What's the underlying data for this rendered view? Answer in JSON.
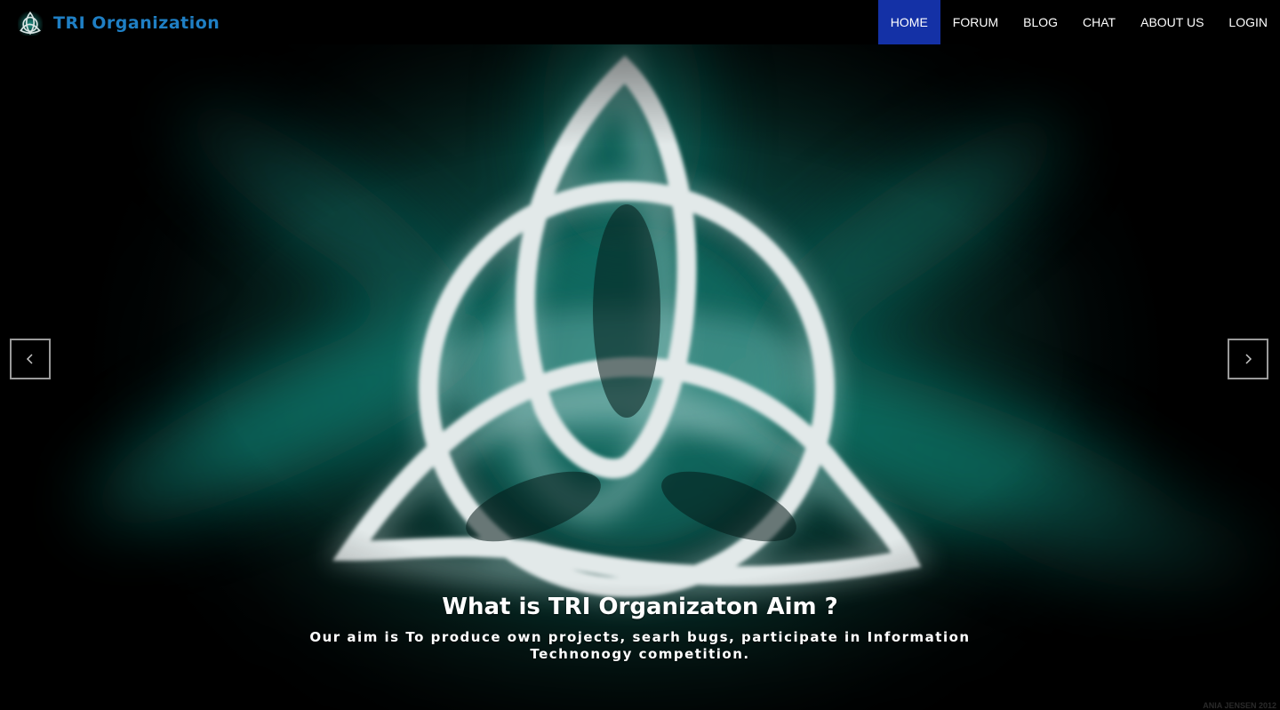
{
  "header": {
    "brand_name": "TRI Organization",
    "brand_logo_icon": "triquetra-logo-icon",
    "brand_color": "#1f7fc4"
  },
  "nav": {
    "active_color": "#1431a6",
    "items": [
      {
        "label": "HOME",
        "active": true
      },
      {
        "label": "FORUM",
        "active": false
      },
      {
        "label": "BLOG",
        "active": false
      },
      {
        "label": "CHAT",
        "active": false
      },
      {
        "label": "ABOUT US",
        "active": false
      },
      {
        "label": "LOGIN",
        "active": false
      }
    ]
  },
  "carousel": {
    "caption_title": "What is TRI Organizaton Aim ?",
    "caption_text": "Our aim is To produce own projects, searh bugs, participate in Information Technonogy competition.",
    "prev_icon": "chevron-left-icon",
    "next_icon": "chevron-right-icon",
    "image_subject": "triquetra-icon",
    "watermark": "ANIA JENSEN 2012"
  }
}
